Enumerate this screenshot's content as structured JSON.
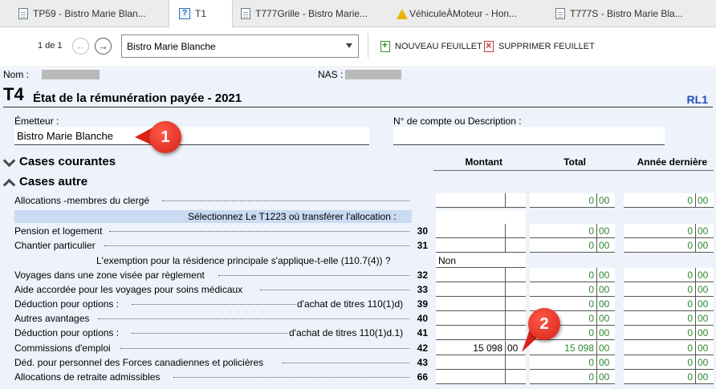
{
  "tabs": [
    {
      "label": "TP59 - Bistro Marie Blan...",
      "icon": "document-icon"
    },
    {
      "label": "T1",
      "icon": "help-icon"
    },
    {
      "label": "T777Grille - Bistro Marie...",
      "icon": "document-icon"
    },
    {
      "label": "VéhiculeÀMoteur - Hon...",
      "icon": "warning-icon"
    },
    {
      "label": "T777S - Bistro Marie Bla...",
      "icon": "document-icon"
    }
  ],
  "toolbar": {
    "pager": "1 de 1",
    "select_value": "Bistro Marie Blanche",
    "new_sheet": "NOUVEAU FEUILLET",
    "delete_sheet": "SUPPRIMER FEUILLET"
  },
  "ident": {
    "nom_label": "Nom :",
    "nas_label": "NAS :"
  },
  "form": {
    "code": "T4",
    "title": "État de la rémunération payée - 2021",
    "rl": "RL1",
    "emetteur_label": "Émetteur :",
    "emetteur_value": "Bistro Marie Blanche",
    "account_label": "N° de compte ou Description :",
    "account_value": ""
  },
  "sections": {
    "current": "Cases courantes",
    "other": "Cases autre"
  },
  "columns": {
    "montant": "Montant",
    "total": "Total",
    "previous": "Année dernière"
  },
  "rows": [
    {
      "label": "Allocations -membres du clergé",
      "code": "",
      "total_int": "0",
      "total_dec": "00",
      "prev_int": "0",
      "prev_dec": "00"
    },
    {
      "note": "Sélectionnez Le T1223 où transférer l'allocation :"
    },
    {
      "label": "Pension et logement",
      "code": "30",
      "total_int": "0",
      "total_dec": "00",
      "prev_int": "0",
      "prev_dec": "00"
    },
    {
      "label": "Chantier particulier",
      "code": "31",
      "total_int": "0",
      "total_dec": "00",
      "prev_int": "0",
      "prev_dec": "00"
    },
    {
      "question": "L'exemption pour la résidence principale s'applique-t-elle (110.7(4)) ?",
      "answer": "Non"
    },
    {
      "label": "Voyages dans une zone visée par règlement",
      "code": "32",
      "total_int": "0",
      "total_dec": "00",
      "prev_int": "0",
      "prev_dec": "00"
    },
    {
      "label": "Aide accordée pour les voyages pour soins médicaux",
      "code": "33",
      "total_int": "0",
      "total_dec": "00",
      "prev_int": "0",
      "prev_dec": "00"
    },
    {
      "label": "Déduction pour options :",
      "mid": "d'achat de titres 110(1)d)",
      "code": "39",
      "total_int": "0",
      "total_dec": "00",
      "prev_int": "0",
      "prev_dec": "00"
    },
    {
      "label": "Autres avantages",
      "code": "40",
      "total_int": "0",
      "total_dec": "00",
      "prev_int": "0",
      "prev_dec": "00"
    },
    {
      "label": "Déduction pour options :",
      "mid": "d'achat de titres 110(1)d.1)",
      "code": "41",
      "total_int": "0",
      "total_dec": "00",
      "prev_int": "0",
      "prev_dec": "00"
    },
    {
      "label": "Commissions d'emploi",
      "code": "42",
      "amt_int": "15 098",
      "amt_dec": "00",
      "total_int": "15 098",
      "total_dec": "00",
      "prev_int": "0",
      "prev_dec": "00"
    },
    {
      "label": "Déd. pour personnel des Forces canadiennes et policières",
      "code": "43",
      "total_int": "0",
      "total_dec": "00",
      "prev_int": "0",
      "prev_dec": "00"
    },
    {
      "label": "Allocations de retraite admissibles",
      "code": "66",
      "total_int": "0",
      "total_dec": "00",
      "prev_int": "0",
      "prev_dec": "00"
    }
  ],
  "callouts": [
    "1",
    "2"
  ]
}
